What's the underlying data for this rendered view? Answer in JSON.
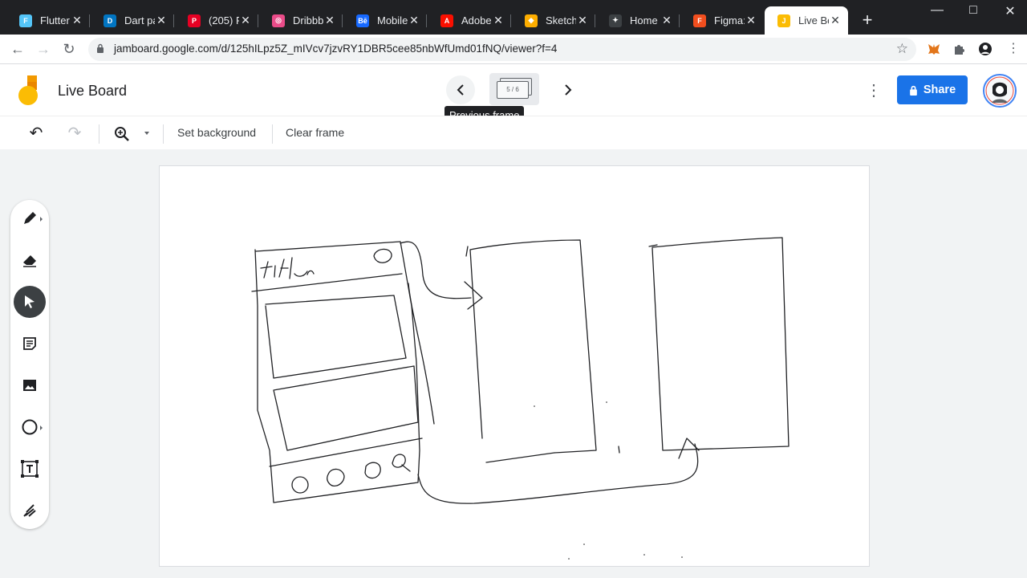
{
  "browser": {
    "tabs": [
      {
        "title": "Flutter",
        "color": "#54c5f8",
        "glyph": "F"
      },
      {
        "title": "Dart pa",
        "color": "#0175c2",
        "glyph": "D"
      },
      {
        "title": "(205) Pi",
        "color": "#e60023",
        "glyph": "P"
      },
      {
        "title": "Dribbbl",
        "color": "#ea4c89",
        "glyph": "◎"
      },
      {
        "title": "Mobile",
        "color": "#1769ff",
        "glyph": "Bē"
      },
      {
        "title": "Adobe",
        "color": "#fa0f00",
        "glyph": "A"
      },
      {
        "title": "Sketch",
        "color": "#fdad00",
        "glyph": "◆"
      },
      {
        "title": "Home |",
        "color": "#3c4043",
        "glyph": "✦"
      },
      {
        "title": "Figma:",
        "color": "#f24e1e",
        "glyph": "F"
      },
      {
        "title": "Live Bo",
        "color": "#fbbc04",
        "glyph": "J"
      }
    ],
    "url": "jamboard.google.com/d/125hILpz5Z_mIVcv7jzvRY1DBR5cee85nbWfUmd01fNQ/viewer?f=4",
    "new_tab": "+"
  },
  "app": {
    "title": "Live Board",
    "frame_indicator": "5 / 6",
    "tooltip": "Previous frame",
    "share_label": "Share",
    "accent": "#1a73e8"
  },
  "edit_toolbar": {
    "set_background": "Set background",
    "clear_frame": "Clear frame"
  },
  "sketch": {
    "title_text": "title"
  }
}
